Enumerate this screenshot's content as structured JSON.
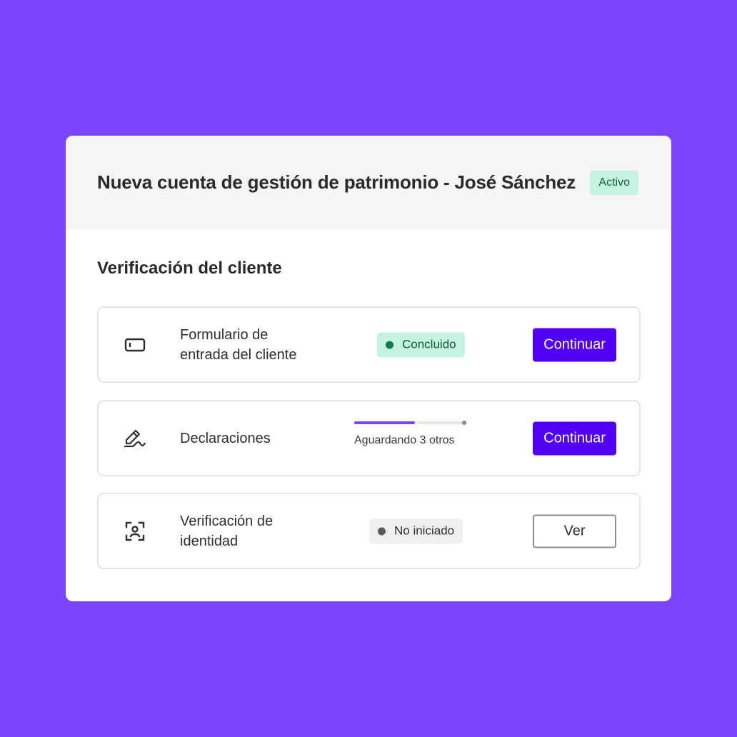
{
  "header": {
    "title": "Nueva cuenta de gestión de patrimonio - José Sánchez",
    "status_badge": "Activo"
  },
  "section": {
    "title": "Verificación del cliente"
  },
  "rows": [
    {
      "icon": "id-card-icon",
      "label_line1": "Formulario de",
      "label_line2": "entrada del cliente",
      "status": "Concluido",
      "button": "Continuar"
    },
    {
      "icon": "signature-pen-icon",
      "label": "Declaraciones",
      "progress": 0.55,
      "progress_text": "Aguardando 3 otros",
      "button": "Continuar"
    },
    {
      "icon": "face-scan-icon",
      "label_line1": "Verificación de",
      "label_line2": "identidad",
      "status": "No iniciado",
      "button": "Ver"
    }
  ],
  "colors": {
    "background": "#7b45fe",
    "primary_button": "#5200f5",
    "progress_fill": "#7b45fe",
    "progress_track": "#e6e6e6",
    "success_bg": "#c4f4e1",
    "success_text": "#0f5c3f"
  }
}
